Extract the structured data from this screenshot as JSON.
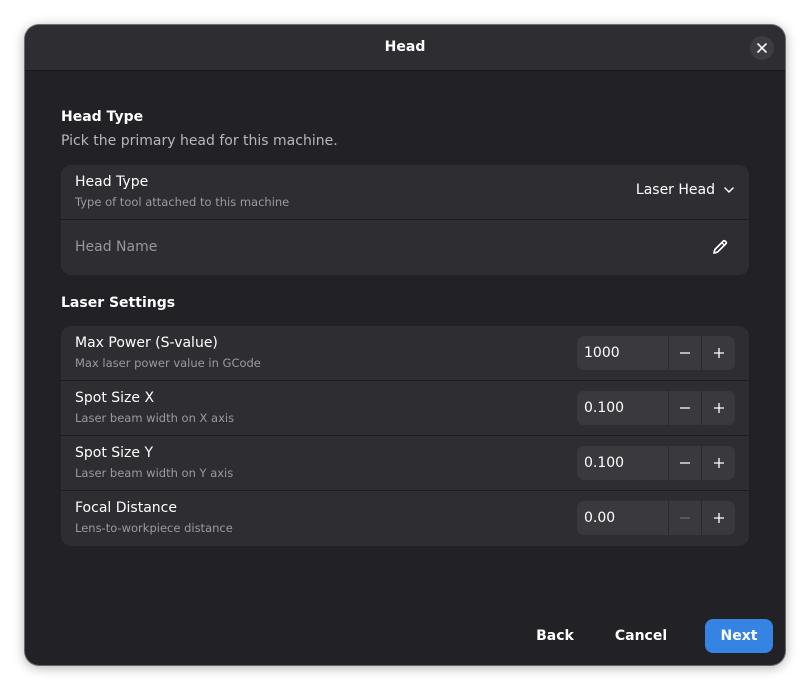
{
  "dialog": {
    "title": "Head",
    "close_icon": "close-icon"
  },
  "head_section": {
    "title": "Head Type",
    "description": "Pick the primary head for this machine.",
    "rows": {
      "head_type": {
        "title": "Head Type",
        "subtitle": "Type of tool attached to this machine",
        "selected": "Laser Head"
      },
      "head_name": {
        "placeholder": "Head Name",
        "value": ""
      }
    }
  },
  "laser_section": {
    "title": "Laser Settings",
    "rows": [
      {
        "title": "Max Power (S-value)",
        "subtitle": "Max laser power value in GCode",
        "value": "1000",
        "minus_enabled": true
      },
      {
        "title": "Spot Size X",
        "subtitle": "Laser beam width on X axis",
        "value": "0.100",
        "minus_enabled": true
      },
      {
        "title": "Spot Size Y",
        "subtitle": "Laser beam width on Y axis",
        "value": "0.100",
        "minus_enabled": true
      },
      {
        "title": "Focal Distance",
        "subtitle": "Lens-to-workpiece distance",
        "value": "0.00",
        "minus_enabled": false
      }
    ]
  },
  "footer": {
    "back_label": "Back",
    "cancel_label": "Cancel",
    "next_label": "Next"
  },
  "colors": {
    "accent": "#3584e4",
    "dialog_bg": "#222226",
    "card_bg": "#2e2e32"
  }
}
